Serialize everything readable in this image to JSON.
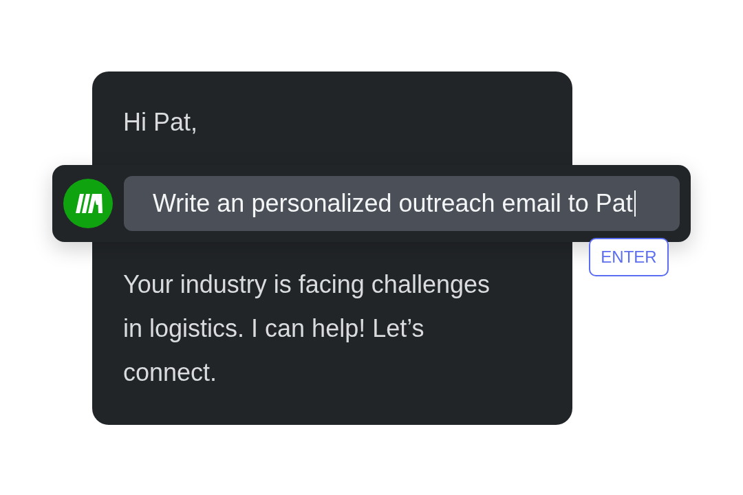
{
  "email": {
    "greeting": "Hi Pat,",
    "body": "Your industry is facing challenges in logistics. I can help! Let’s connect."
  },
  "prompt": {
    "value": "Write an personalized outreach email to Pat",
    "focused": true,
    "key_hint": "ENTER"
  }
}
